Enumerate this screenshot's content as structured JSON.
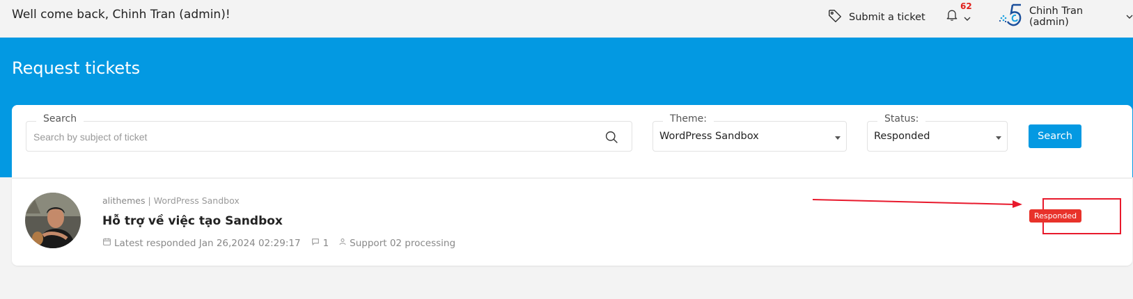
{
  "header": {
    "welcome": "Well come back, Chinh Tran (admin)!",
    "submit_label": "Submit a ticket",
    "notification_count": "62",
    "user_name": "Chinh Tran (admin)"
  },
  "hero": {
    "title": "Request tickets"
  },
  "filters": {
    "search_label": "Search",
    "search_placeholder": "Search by subject of ticket",
    "theme_label": "Theme:",
    "theme_value": "WordPress Sandbox",
    "status_label": "Status:",
    "status_value": "Responded",
    "search_button": "Search"
  },
  "tickets": [
    {
      "author": "alithemes",
      "separator": "|",
      "theme": "WordPress Sandbox",
      "title": "Hỗ trợ về việc tạo Sandbox",
      "latest_responded": "Latest responded Jan 26,2024 02:29:17",
      "comment_count": "1",
      "assignee": "Support 02 processing",
      "status": "Responded"
    }
  ],
  "colors": {
    "accent": "#0399e2",
    "badge": "#e8322a",
    "annotation": "#e8192c"
  }
}
